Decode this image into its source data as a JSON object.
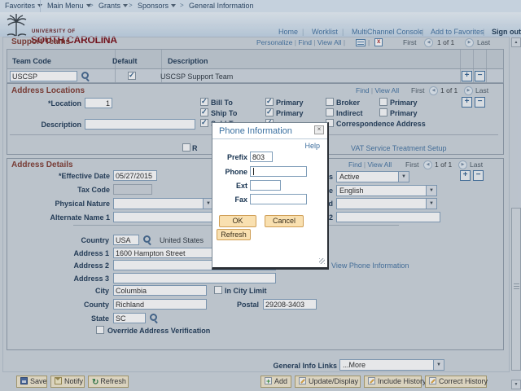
{
  "icons": {
    "dropdown": "▼",
    "prev": "◀",
    "next": "▶",
    "close": "×",
    "check": "✓",
    "refresh_glyph": "↻",
    "scroll_up": "▲",
    "scroll_down": "▼",
    "crumb_sep": ">"
  },
  "breadcrumb": {
    "favorites": "Favorites",
    "main_menu": "Main Menu",
    "grants": "Grants",
    "sponsors": "Sponsors",
    "current": "General Information"
  },
  "header": {
    "logo_line1": "UNIVERSITY OF",
    "logo_line2": "SOUTH CAROLINA",
    "home": "Home",
    "worklist": "Worklist",
    "multichannel": "MultiChannel Console",
    "add_to_favorites": "Add to Favorites",
    "sign_out": "Sign out"
  },
  "support_teams": {
    "title": "Support Teams",
    "personalize": "Personalize",
    "find": "Find",
    "view_all": "View All",
    "first": "First",
    "count": "1 of 1",
    "last": "Last",
    "col_team_code": "Team Code",
    "col_default": "Default",
    "col_description": "Description",
    "team_code": "USCSP",
    "default_checked": true,
    "description": "USCSP Support Team"
  },
  "address_locations": {
    "title": "Address Locations",
    "find": "Find",
    "view_all": "View All",
    "first": "First",
    "count": "1 of 1",
    "last": "Last",
    "location_label": "*Location",
    "location_value": "1",
    "description_label": "Description",
    "description_value": "",
    "bill_to": "Bill To",
    "ship_to": "Ship To",
    "sold_to": "Sold To",
    "primary": "Primary",
    "broker": "Broker",
    "indirect": "Indirect",
    "correspondence": "Correspondence Address",
    "bill_to_checked": true,
    "ship_to_checked": true,
    "sold_to_checked": true,
    "primary_mid_checked": true,
    "broker_checked": false,
    "indirect_checked": false,
    "correspondence_checked": false,
    "primary_right_checked": false,
    "partial_label": "R",
    "partial_checked": false,
    "vat_link": "VAT Service Treatment Setup"
  },
  "address_details": {
    "title": "Address Details",
    "find": "Find",
    "view_all": "View All",
    "first": "First",
    "count": "1 of 1",
    "last": "Last",
    "effective_date_label": "*Effective Date",
    "effective_date": "05/27/2015",
    "status_label_fragment": "us",
    "status_value": "Active",
    "tax_code_label": "Tax Code",
    "tax_code_value": "",
    "language_label_fragment": "de",
    "language_value": "English",
    "physical_nature_label": "Physical Nature",
    "physical_nature_value": "",
    "preferred_label_fragment": "ed",
    "preferred_value": "",
    "alt_name1_label": "Alternate Name 1",
    "alt_name1_value": "",
    "alt_name2_label_fragment": "e 2",
    "alt_name2_value": "",
    "country_label": "Country",
    "country_code": "USA",
    "country_name": "United States",
    "address1_label": "Address 1",
    "address1": "1600 Hampton Street",
    "address2_label": "Address 2",
    "address2": "",
    "address3_label": "Address 3",
    "address3": "",
    "city_label": "City",
    "city": "Columbia",
    "in_city_limit": "In City Limit",
    "in_city_limit_checked": false,
    "county_label": "County",
    "county": "Richland",
    "postal_label": "Postal",
    "postal": "29208-3403",
    "state_label": "State",
    "state": "SC",
    "override_label": "Override Address Verification",
    "override_checked": false,
    "view_phone_link": "View Phone Information"
  },
  "general_info": {
    "label": "General Info Links",
    "value": "...More"
  },
  "toolbar": {
    "save": "Save",
    "notify": "Notify",
    "refresh": "Refresh",
    "add": "Add",
    "update_display": "Update/Display",
    "include_history": "Include History",
    "correct_history": "Correct History"
  },
  "modal": {
    "title": "Phone Information",
    "help": "Help",
    "prefix_label": "Prefix",
    "prefix_value": "803",
    "phone_label": "Phone",
    "phone_value": "",
    "ext_label": "Ext",
    "ext_value": "",
    "fax_label": "Fax",
    "fax_value": "",
    "ok": "OK",
    "cancel": "Cancel",
    "refresh": "Refresh"
  }
}
